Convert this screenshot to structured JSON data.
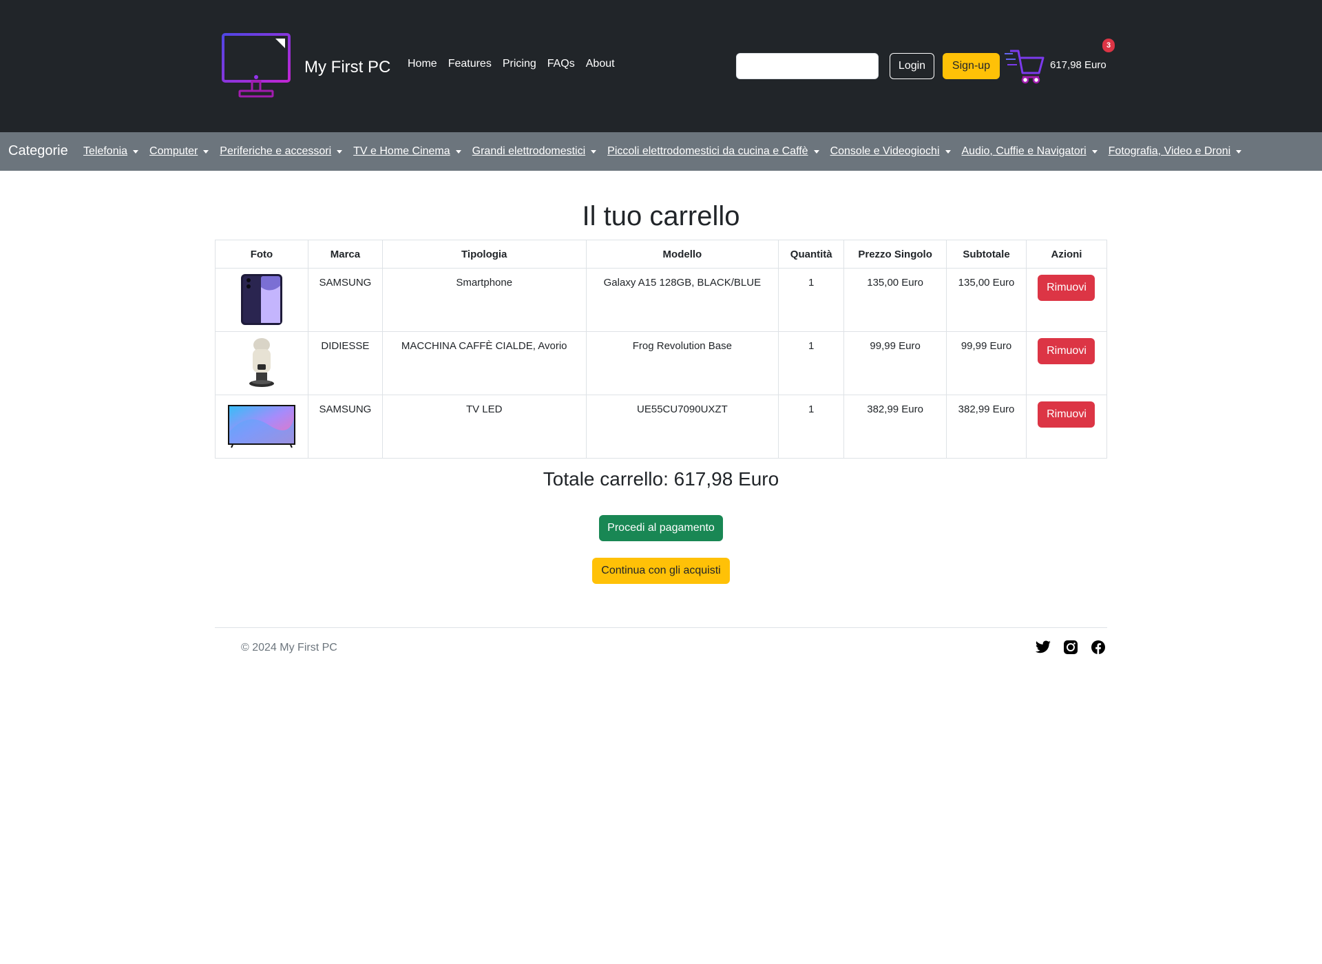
{
  "header": {
    "brand": "My First PC",
    "nav": [
      "Home",
      "Features",
      "Pricing",
      "FAQs",
      "About"
    ],
    "search": {
      "value": "",
      "placeholder": ""
    },
    "login_label": "Login",
    "signup_label": "Sign-up",
    "cart_count": "3",
    "cart_total": "617,98 Euro",
    "logo_icon": "monitor-icon",
    "cart_icon": "shopping-cart-icon"
  },
  "categories": {
    "title": "Categorie",
    "items": [
      "Telefonia",
      "Computer",
      "Periferiche e accessori",
      "TV e Home Cinema",
      "Grandi elettrodomestici",
      "Piccoli elettrodomestici da cucina e Caffè",
      "Console e Videogiochi",
      "Audio, Cuffie e Navigatori",
      "Fotografia, Video e Droni"
    ]
  },
  "cart": {
    "title": "Il tuo carrello",
    "columns": [
      "Foto",
      "Marca",
      "Tipologia",
      "Modello",
      "Quantità",
      "Prezzo Singolo",
      "Subtotale",
      "Azioni"
    ],
    "rows": [
      {
        "photo": "smartphone-image",
        "brand": "SAMSUNG",
        "type": "Smartphone",
        "model": "Galaxy A15 128GB, BLACK/BLUE",
        "qty": "1",
        "price": "135,00 Euro",
        "subtotal": "135,00 Euro",
        "action": "Rimuovi"
      },
      {
        "photo": "coffee-machine-image",
        "brand": "DIDIESSE",
        "type": "MACCHINA CAFFÈ CIALDE, Avorio",
        "model": "Frog Revolution Base",
        "qty": "1",
        "price": "99,99 Euro",
        "subtotal": "99,99 Euro",
        "action": "Rimuovi"
      },
      {
        "photo": "tv-image",
        "brand": "SAMSUNG",
        "type": "TV LED",
        "model": "UE55CU7090UXZT",
        "qty": "1",
        "price": "382,99 Euro",
        "subtotal": "382,99 Euro",
        "action": "Rimuovi"
      }
    ],
    "total_label": "Totale carrello: 617,98 Euro",
    "pay_label": "Procedi al pagamento",
    "continue_label": "Continua con gli acquisti"
  },
  "footer": {
    "copyright": "© 2024 My First PC",
    "social": [
      "twitter-icon",
      "instagram-icon",
      "facebook-icon"
    ]
  },
  "colors": {
    "header_bg": "#212529",
    "category_bg": "#6c757d",
    "accent_purple": "#7c3aed",
    "warning": "#ffc107",
    "danger": "#dc3545",
    "success": "#198754"
  }
}
